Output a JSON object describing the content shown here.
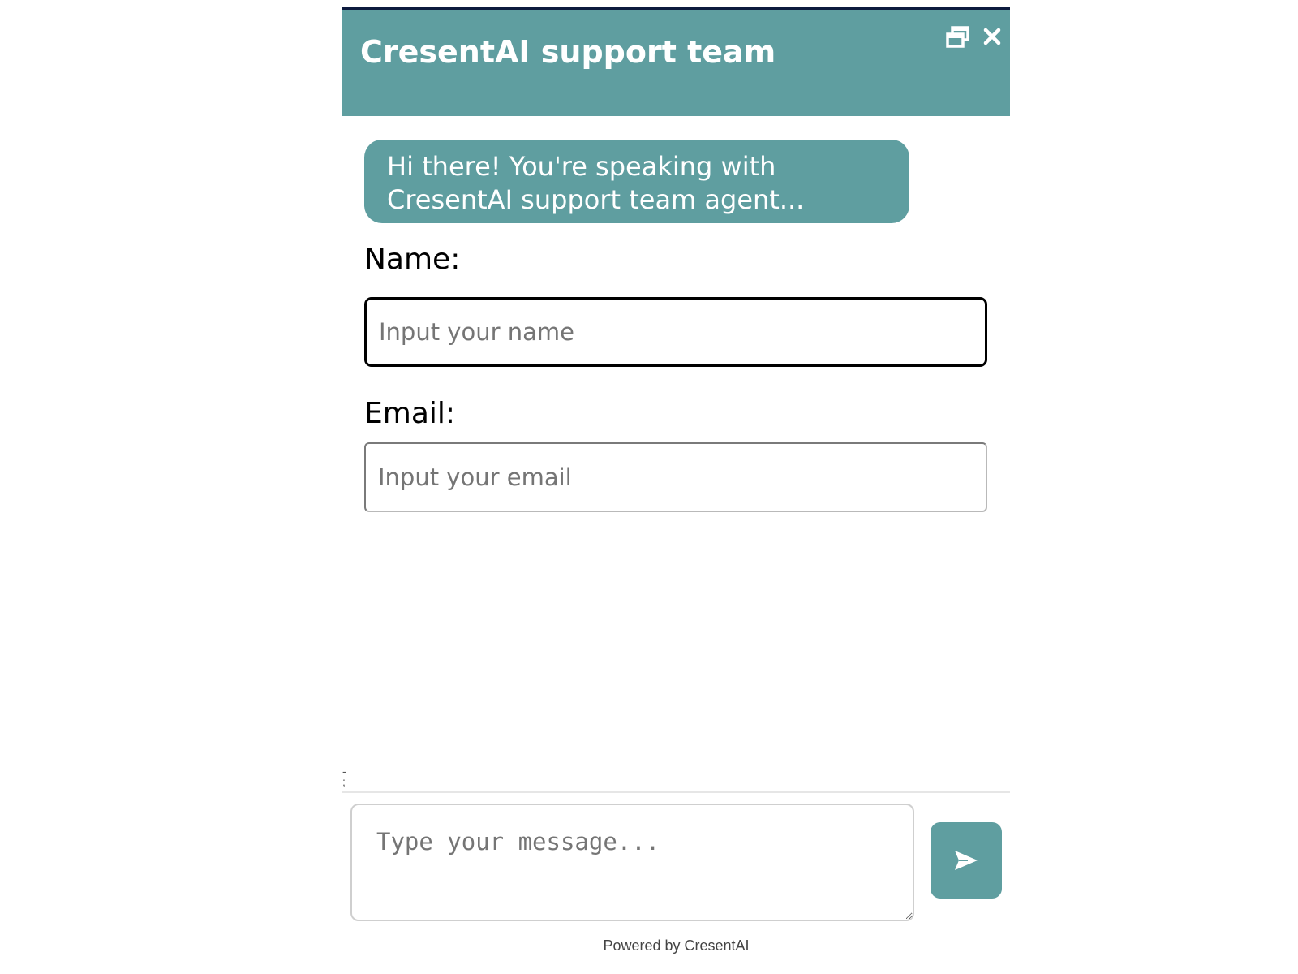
{
  "header": {
    "title": "CresentAI support team",
    "background_color": "#5f9ea0",
    "top_border_color": "#0d1b3e",
    "icons": [
      "restore-icon",
      "close-icon"
    ]
  },
  "greeting": {
    "text_line1": "Hi there! You're speaking with",
    "text_line2": "CresentAI support team agent..."
  },
  "form": {
    "name_label": "Name:",
    "name_placeholder": "Input your name",
    "name_value": "",
    "email_label": "Email:",
    "email_placeholder": "Input your email",
    "email_value": ""
  },
  "composer": {
    "message_placeholder": "Type your message...",
    "message_value": "",
    "send_icon": "send-icon"
  },
  "footer": {
    "powered_by": "Powered by CresentAI"
  }
}
